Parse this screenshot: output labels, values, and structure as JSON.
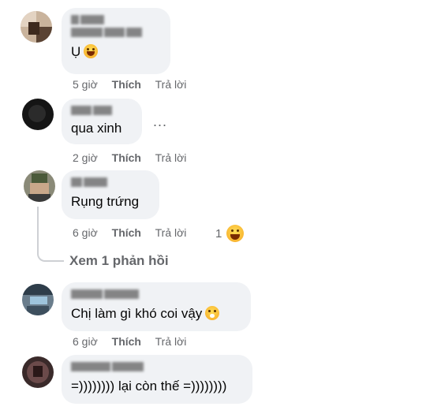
{
  "comments": [
    {
      "name": "",
      "text": "Ụ",
      "emoji": "rolling-laughing-emoji",
      "actions": {
        "time": "5 giờ",
        "like": "Thích",
        "reply": "Trả lời"
      }
    },
    {
      "name": "",
      "text": "qua xinh",
      "more": "...",
      "actions": {
        "time": "2 giờ",
        "like": "Thích",
        "reply": "Trả lời"
      }
    },
    {
      "name": "",
      "text": "Rụng trứng",
      "actions": {
        "time": "6 giờ",
        "like": "Thích",
        "reply": "Trả lời"
      },
      "reaction_count": "1",
      "reaction_emoji": "laughing-emoji",
      "view_replies": "Xem 1 phản hồi"
    },
    {
      "name": "",
      "text": "Chị làm gì khó coi vậy",
      "emoji": "scared-face-emoji",
      "actions": {
        "time": "6 giờ",
        "like": "Thích",
        "reply": "Trả lời"
      }
    },
    {
      "name": "",
      "text": "=)))))))) lại còn thế =))))))))"
    }
  ],
  "colors": {
    "bubble": "#f0f2f5",
    "meta": "#65676b",
    "text": "#050505"
  }
}
